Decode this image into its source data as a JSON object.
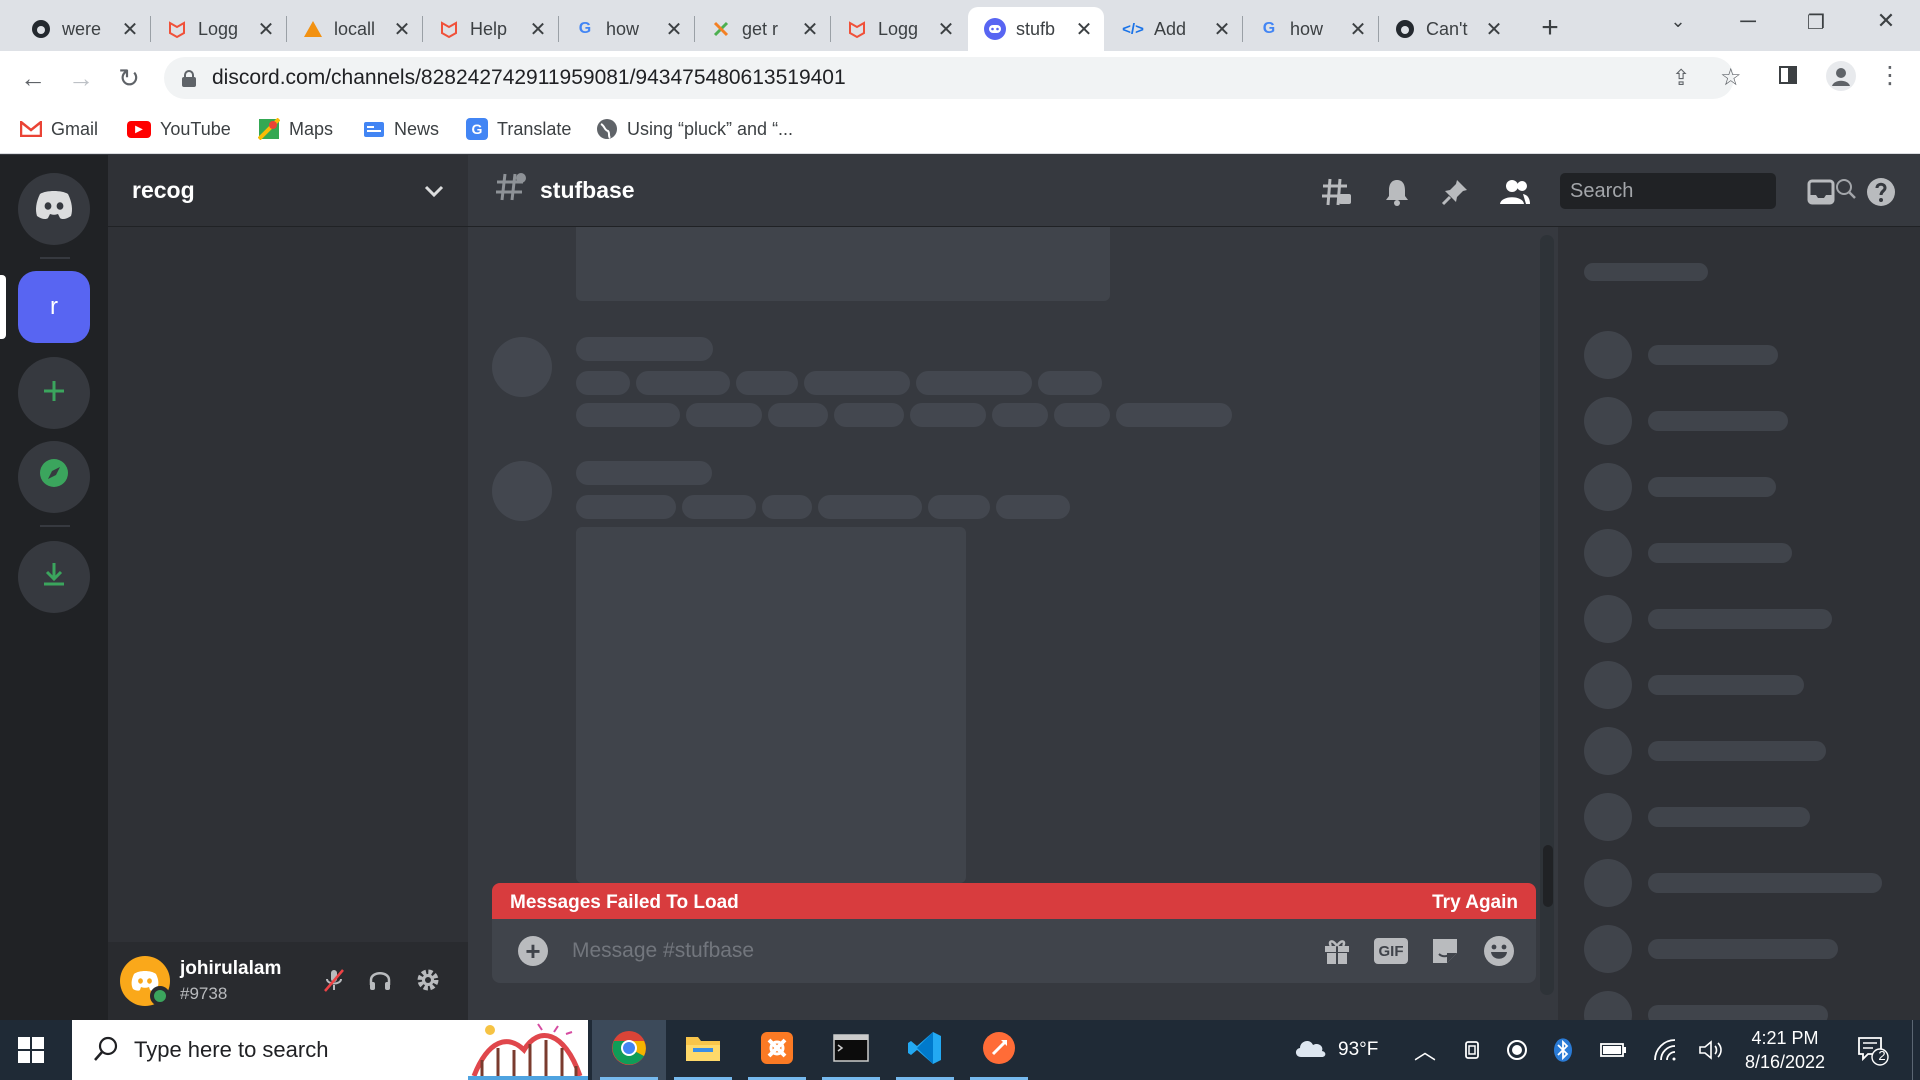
{
  "browser": {
    "tabs": [
      {
        "title": "were",
        "icon": "github-icon",
        "active": false
      },
      {
        "title": "Logg",
        "icon": "laravel-icon",
        "active": false
      },
      {
        "title": "locall",
        "icon": "phpmyadmin-icon",
        "active": false
      },
      {
        "title": "Help",
        "icon": "laravel-icon",
        "active": false
      },
      {
        "title": "how",
        "icon": "google-icon",
        "active": false
      },
      {
        "title": "get r",
        "icon": "stackoverflow-icon",
        "active": false
      },
      {
        "title": "Logg",
        "icon": "laravel-icon",
        "active": false
      },
      {
        "title": "stufb",
        "icon": "discord-icon",
        "active": true
      },
      {
        "title": "Add",
        "icon": "code-icon",
        "active": false
      },
      {
        "title": "how",
        "icon": "google-icon",
        "active": false
      },
      {
        "title": "Can't",
        "icon": "github-icon",
        "active": false
      }
    ],
    "new_tab_label": "+",
    "address": "discord.com/channels/828242742911959081/943475480613519401",
    "bookmarks": [
      {
        "label": "Gmail",
        "icon": "gmail-icon"
      },
      {
        "label": "YouTube",
        "icon": "youtube-icon"
      },
      {
        "label": "Maps",
        "icon": "maps-icon"
      },
      {
        "label": "News",
        "icon": "news-icon"
      },
      {
        "label": "Translate",
        "icon": "translate-icon"
      },
      {
        "label": "Using “pluck” and “...",
        "icon": "globe-icon"
      }
    ]
  },
  "discord": {
    "server_icon_letter": "r",
    "server_name": "recog",
    "channel_name": "stufbase",
    "search_placeholder": "Search",
    "user": {
      "name": "johirulalam",
      "tag": "#9738"
    },
    "error_message": "Messages Failed To Load",
    "retry_label": "Try Again",
    "message_placeholder": "Message #stufbase",
    "gif_label": "GIF"
  },
  "taskbar": {
    "search_placeholder": "Type here to search",
    "weather": "93°F",
    "time": "4:21 PM",
    "date": "8/16/2022",
    "notification_count": "2"
  },
  "colors": {
    "blurple": "#5865f2",
    "discord_green": "#3ba55d",
    "error_red": "#d83c3e",
    "avatar_orange": "#faa81a"
  }
}
